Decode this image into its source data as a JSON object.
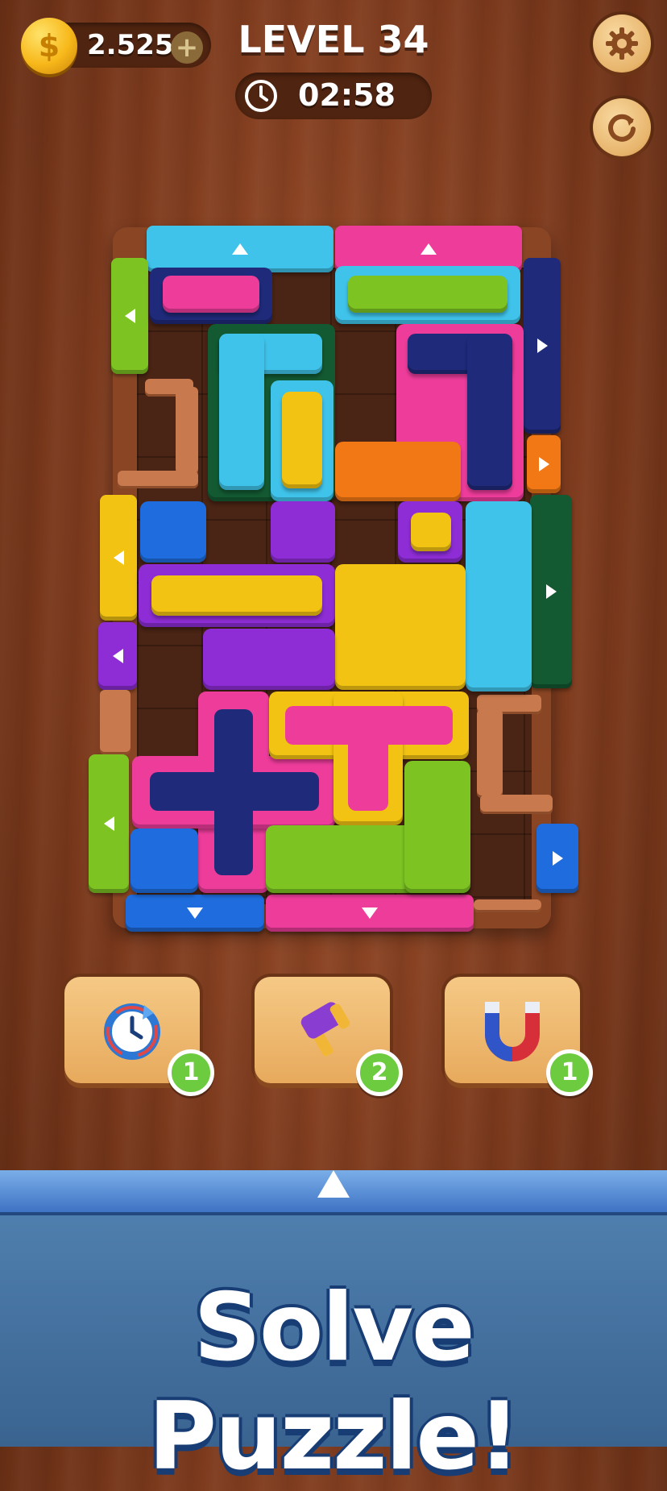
{
  "hud": {
    "coins": "2.525",
    "level_label": "LEVEL 34",
    "timer": "02:58"
  },
  "buttons": {
    "settings": "gear-icon",
    "restart": "refresh-icon"
  },
  "powerups": [
    {
      "name": "time-freeze",
      "icon": "clock-ring-icon",
      "count": "1"
    },
    {
      "name": "hammer",
      "icon": "hammer-icon",
      "count": "2"
    },
    {
      "name": "magnet",
      "icon": "magnet-icon",
      "count": "1"
    }
  ],
  "banner": {
    "text": "Solve Puzzle!"
  },
  "colors": {
    "cyan": "#3fc3ea",
    "pink": "#ee3c9b",
    "green": "#7dc423",
    "navy": "#1f2a7a",
    "orange": "#f17814",
    "yellow": "#f2c313",
    "blue": "#1e6cdd",
    "purple": "#8e2dd6",
    "darkgreen": "#135a32"
  }
}
